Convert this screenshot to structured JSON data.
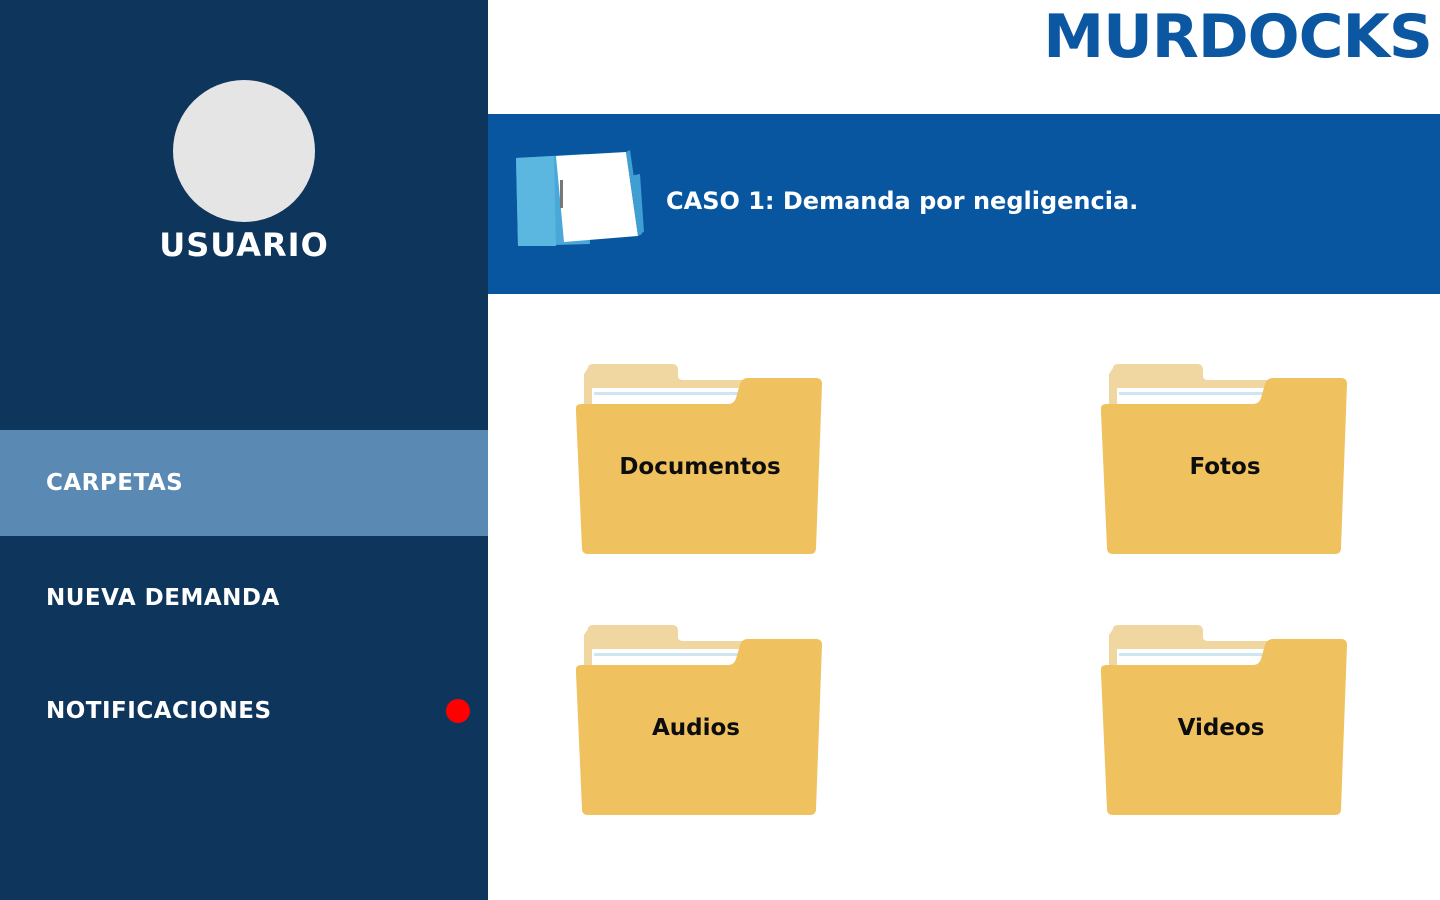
{
  "brand": {
    "logo_text": "MURDOCKS",
    "color": "#0b57a1"
  },
  "sidebar": {
    "user_name": "USUARIO",
    "items": [
      {
        "label": "CARPETAS",
        "active": true
      },
      {
        "label": "NUEVA DEMANDA",
        "active": false
      },
      {
        "label": "NOTIFICACIONES",
        "active": false,
        "badge_color": "#ff0000"
      }
    ]
  },
  "case": {
    "title": "CASO 1: Demanda por negligencia.",
    "icon": "binder-folder-icon"
  },
  "folders": [
    {
      "label": "Documentos",
      "icon": "folder-icon"
    },
    {
      "label": "Fotos",
      "icon": "folder-icon"
    },
    {
      "label": "Audios",
      "icon": "folder-icon"
    },
    {
      "label": "Videos",
      "icon": "folder-icon"
    }
  ],
  "colors": {
    "sidebar_bg": "#0e355c",
    "sidebar_active": "#5a8ab4",
    "banner_bg": "#0956a0",
    "folder_front": "#efc15f",
    "folder_back": "#f0d6a0"
  }
}
